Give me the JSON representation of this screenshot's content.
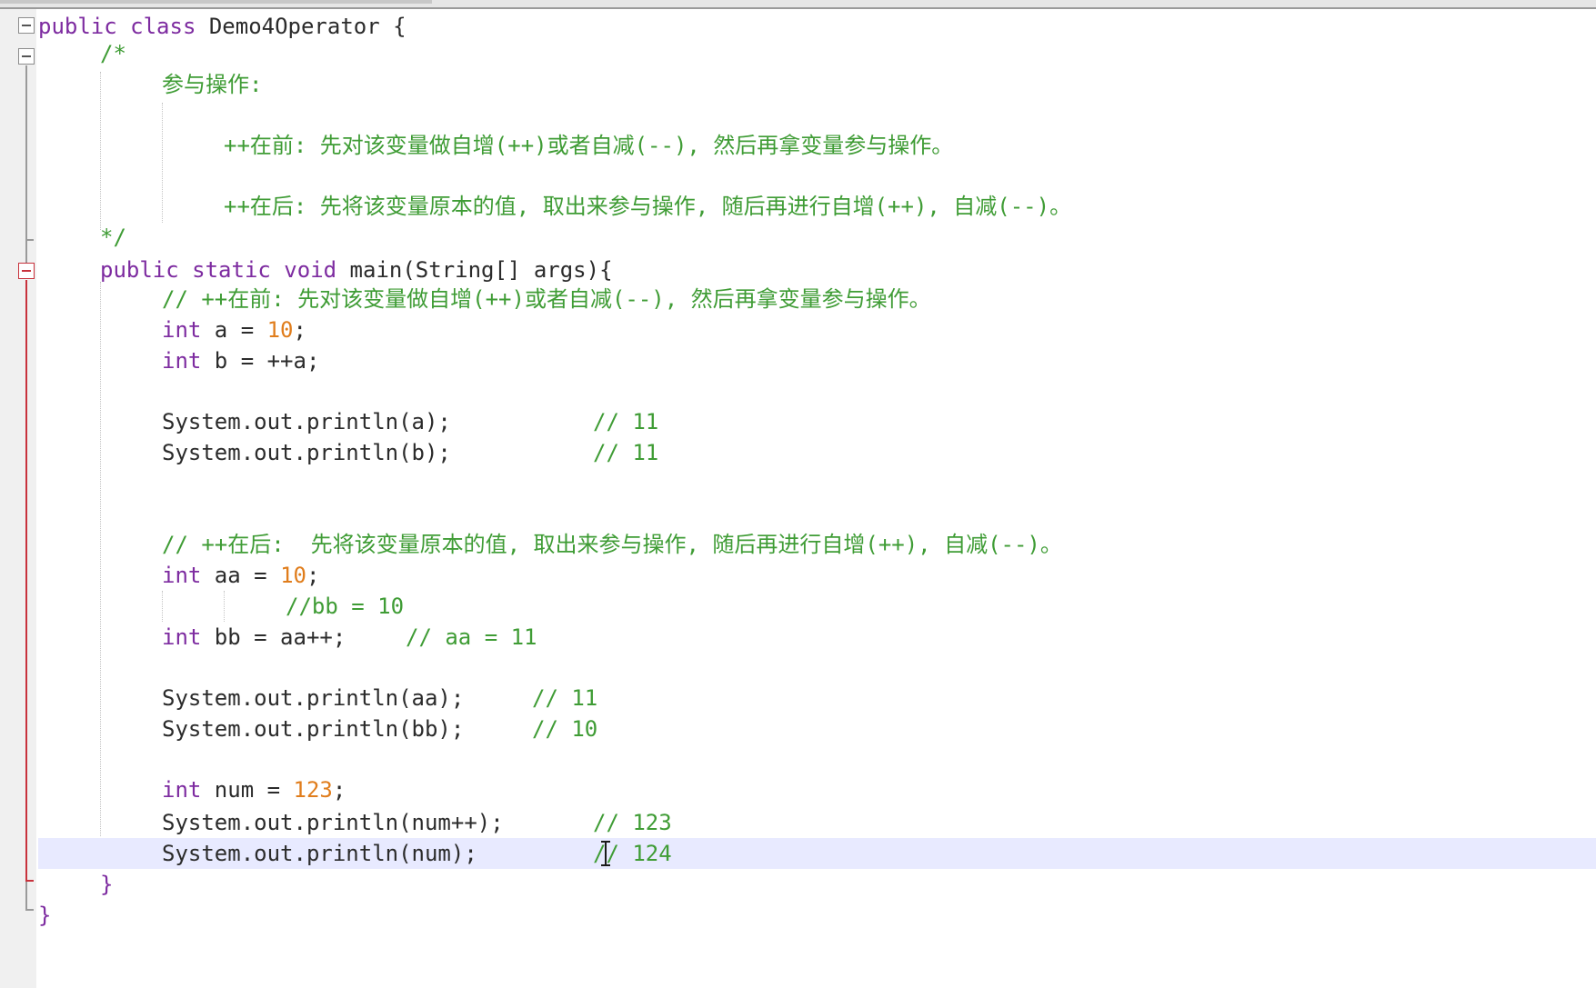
{
  "editor": {
    "language": "java",
    "lines": {
      "class_decl": {
        "kw": "public class",
        "rest": " Demo4Operator {"
      },
      "doc_open": "/*",
      "doc_title": "参与操作:",
      "doc_pre": "++在前: 先对该变量做自增(++)或者自减(--), 然后再拿变量参与操作。",
      "doc_post": "++在后: 先将该变量原本的值, 取出来参与操作, 随后再进行自增(++), 自减(--)。",
      "doc_close": "*/",
      "main_decl": {
        "kw": "public static void",
        "rest": " main(String[] args){"
      },
      "cm_pre": "// ++在前: 先对该变量做自增(++)或者自减(--), 然后再拿变量参与操作。",
      "int_a": {
        "kw": "int",
        "mid": " a = ",
        "num": "10",
        "end": ";"
      },
      "int_b": {
        "kw": "int",
        "rest": " b = ++a;"
      },
      "print_a": {
        "code": "System.out.println(a);",
        "comment": "// 11"
      },
      "print_b": {
        "code": "System.out.println(b);",
        "comment": "// 11"
      },
      "cm_post": "// ++在后:  先将该变量原本的值, 取出来参与操作, 随后再进行自增(++), 自减(--)。",
      "int_aa": {
        "kw": "int",
        "mid": " aa = ",
        "num": "10",
        "end": ";"
      },
      "cm_bb": "//bb = 10",
      "int_bb": {
        "kw": "int",
        "rest": " bb = aa++;",
        "comment": "// aa = 11"
      },
      "print_aa": {
        "code": "System.out.println(aa);",
        "comment": "// 11"
      },
      "print_bb": {
        "code": "System.out.println(bb);",
        "comment": "// 10"
      },
      "int_num": {
        "kw": "int",
        "mid": " num = ",
        "num": "123",
        "end": ";"
      },
      "print_num_pp": {
        "code": "System.out.println(num++);",
        "comment": "// 123"
      },
      "print_num": {
        "code": "System.out.println(num);",
        "comment": "// 124"
      },
      "close_main": "}",
      "close_class": "}"
    }
  },
  "colors": {
    "keyword": "#7d2ba0",
    "comment": "#3f9c35",
    "number": "#e07d1c",
    "text": "#2b2b2b",
    "current_line": "#e8eaff",
    "fold_marker": "#c8323c"
  },
  "icons": {
    "fold": "fold-minus-icon",
    "cursor": "text-cursor-icon"
  }
}
